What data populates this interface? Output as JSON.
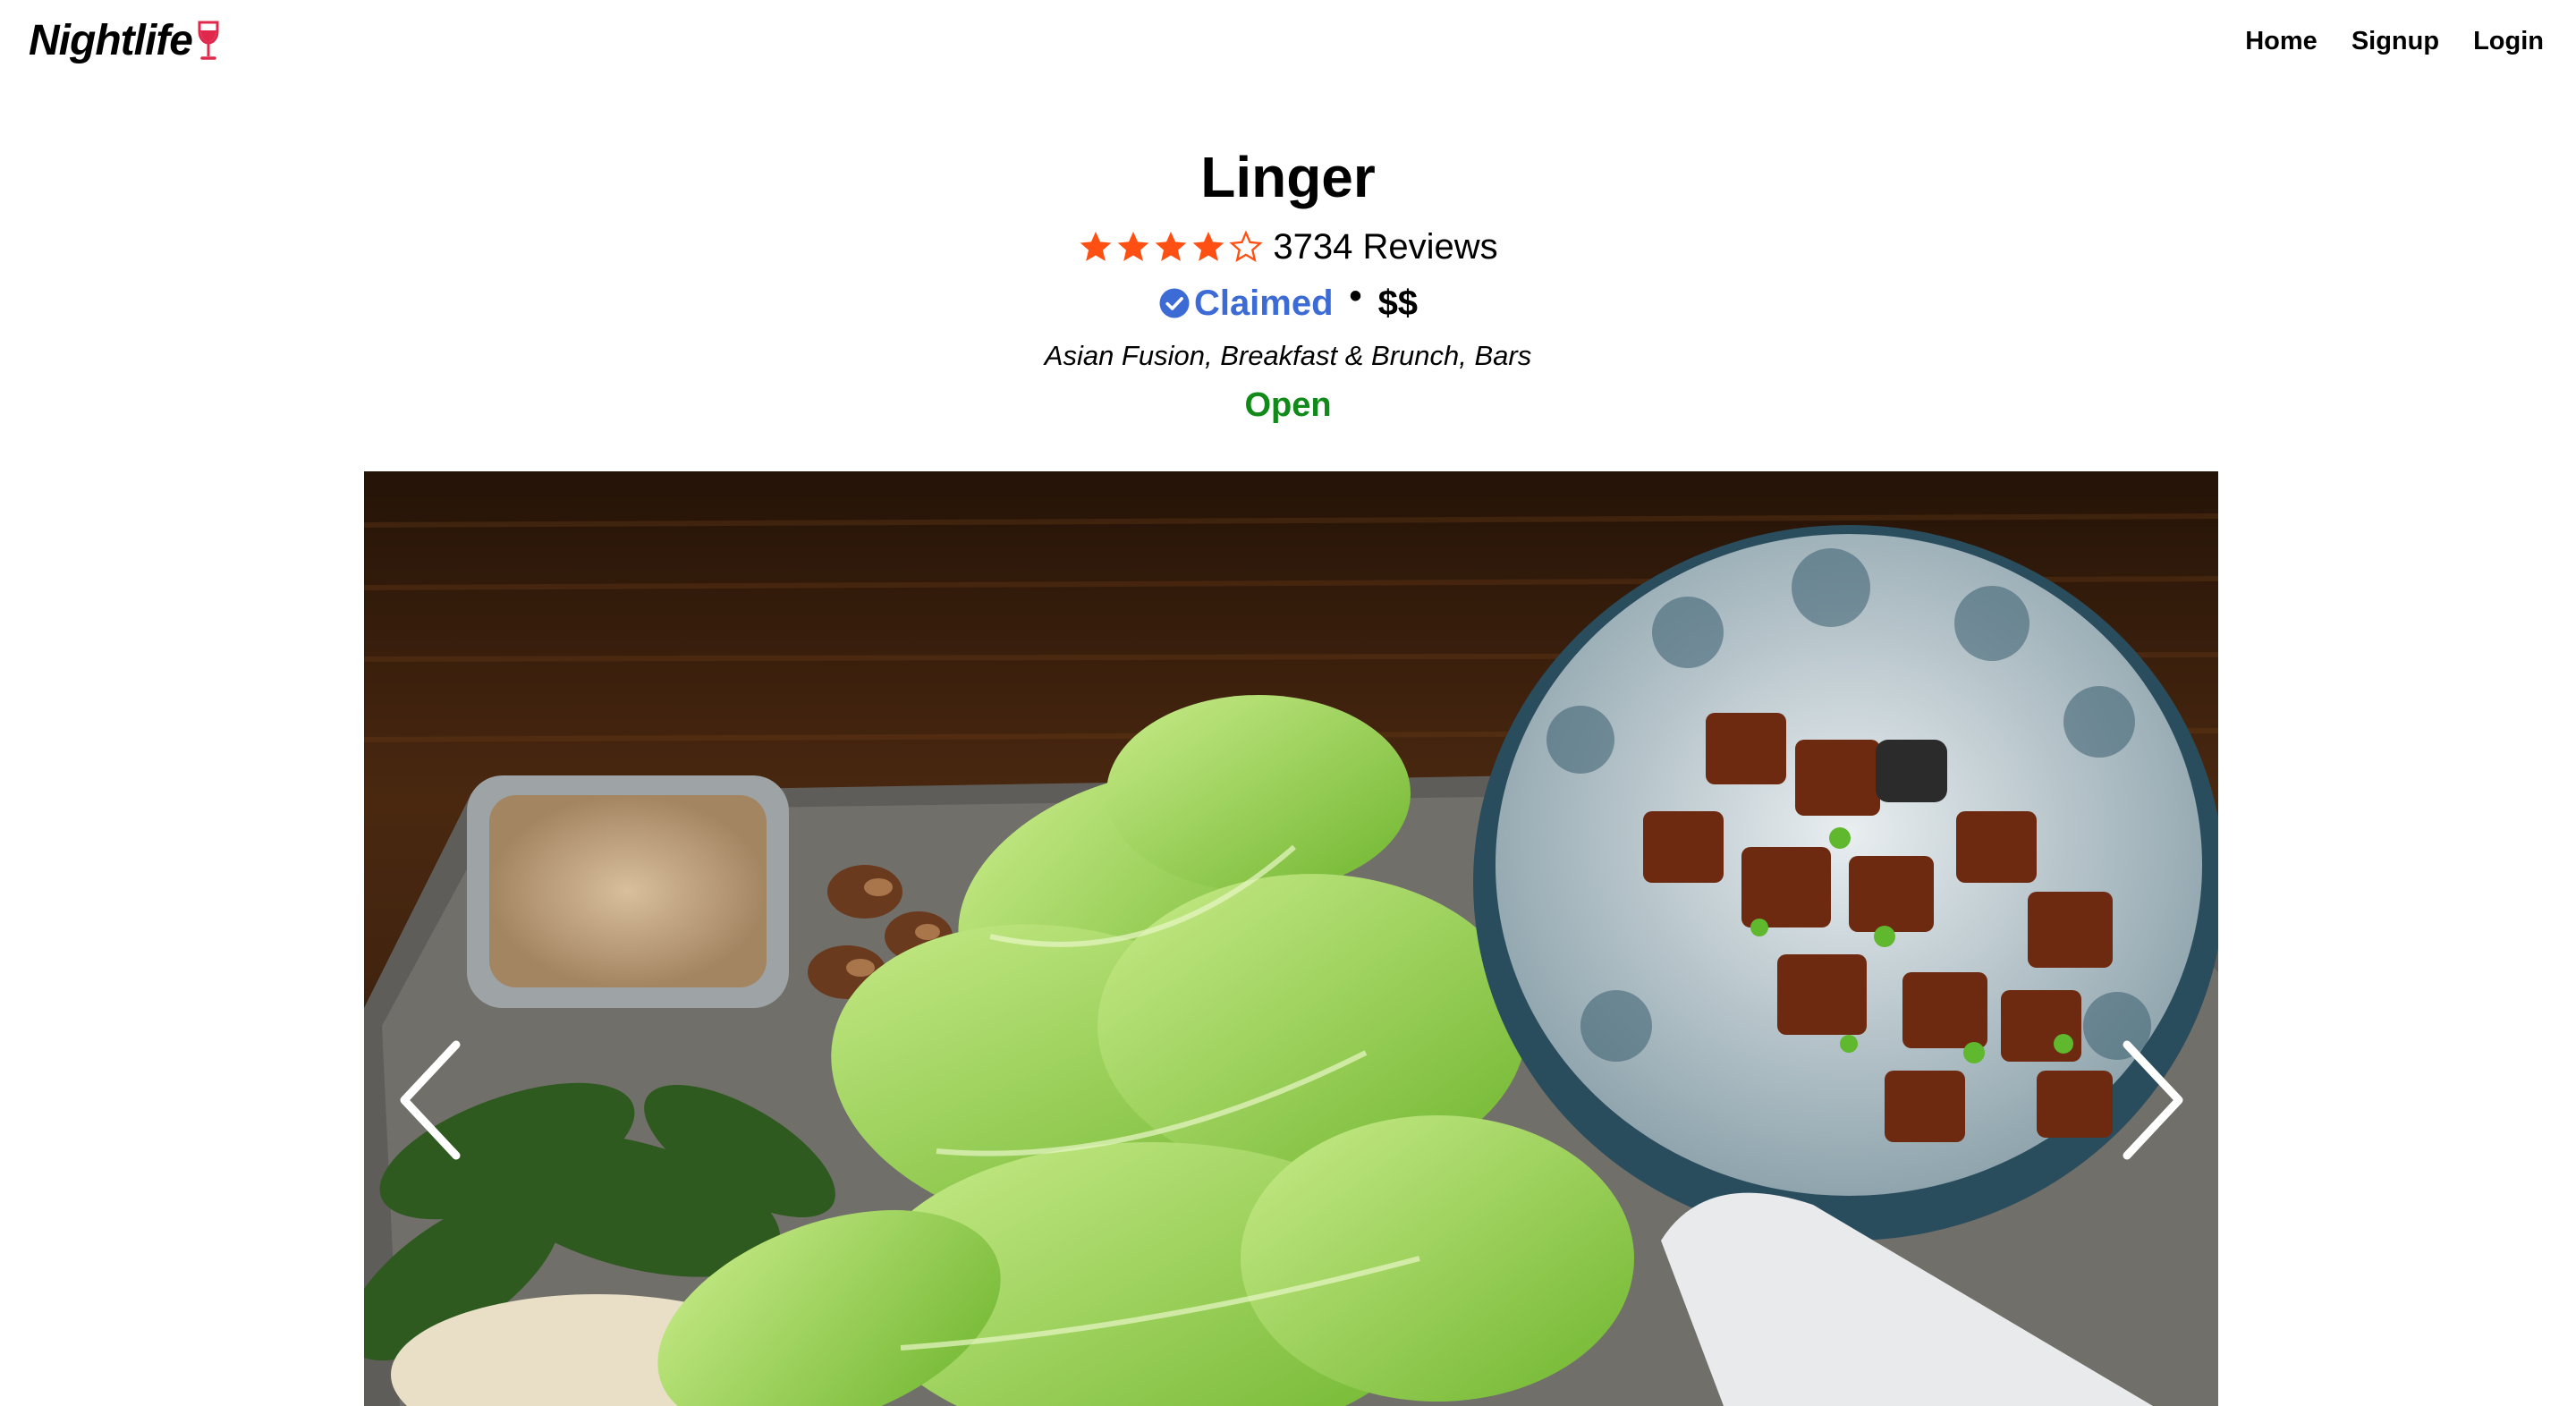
{
  "app": {
    "logo_text": "Nightlife",
    "logo_icon": "wine-glass-icon",
    "brand_color": "#e0284d"
  },
  "nav": {
    "items": [
      {
        "label": "Home"
      },
      {
        "label": "Signup"
      },
      {
        "label": "Login"
      }
    ]
  },
  "business": {
    "name": "Linger",
    "rating": 4,
    "rating_max": 5,
    "star_color": "#ff4f12",
    "review_count_label": "3734 Reviews",
    "claimed_label": "Claimed",
    "claimed_icon": "check-circle-icon",
    "claimed_color": "#3d6bd6",
    "separator": "•",
    "price": "$$",
    "categories": "Asian Fusion, Breakfast & Brunch, Bars",
    "status": "Open",
    "status_color": "#128a19"
  },
  "carousel": {
    "prev_icon": "chevron-left-icon",
    "next_icon": "chevron-right-icon",
    "photo": "food-photo-lettuce-wraps-and-bowl"
  }
}
